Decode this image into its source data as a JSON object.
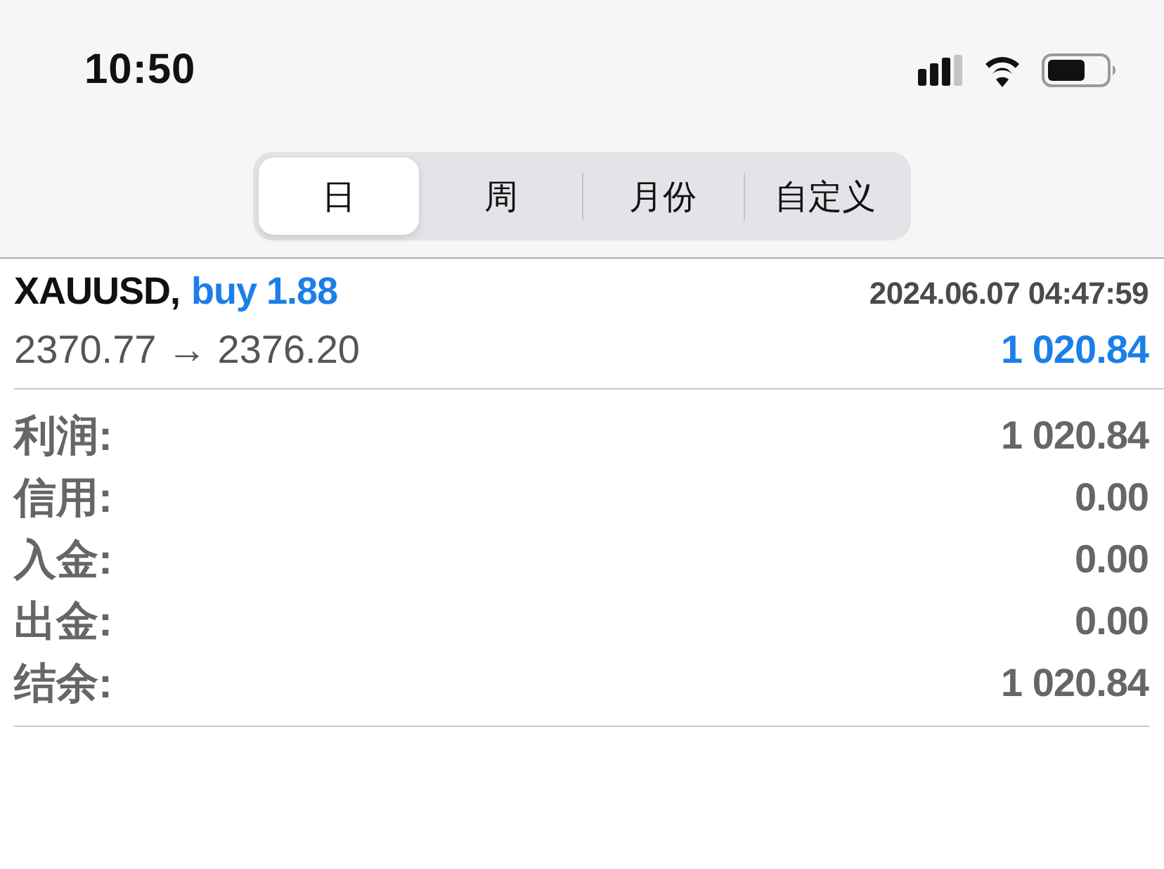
{
  "status_bar": {
    "time": "10:50"
  },
  "period_tabs": [
    {
      "label": "日",
      "selected": true
    },
    {
      "label": "周",
      "selected": false
    },
    {
      "label": "月份",
      "selected": false
    },
    {
      "label": "自定义",
      "selected": false
    }
  ],
  "trade": {
    "symbol": "XAUUSD,",
    "side": "buy 1.88",
    "time": "2024.06.07 04:47:59",
    "prices": "2370.77 → 2376.20",
    "profit": "1 020.84"
  },
  "summary": [
    {
      "label": "利润:",
      "value": "1 020.84"
    },
    {
      "label": "信用:",
      "value": "0.00"
    },
    {
      "label": "入金:",
      "value": "0.00"
    },
    {
      "label": "出金:",
      "value": "0.00"
    },
    {
      "label": "结余:",
      "value": "1 020.84"
    }
  ]
}
